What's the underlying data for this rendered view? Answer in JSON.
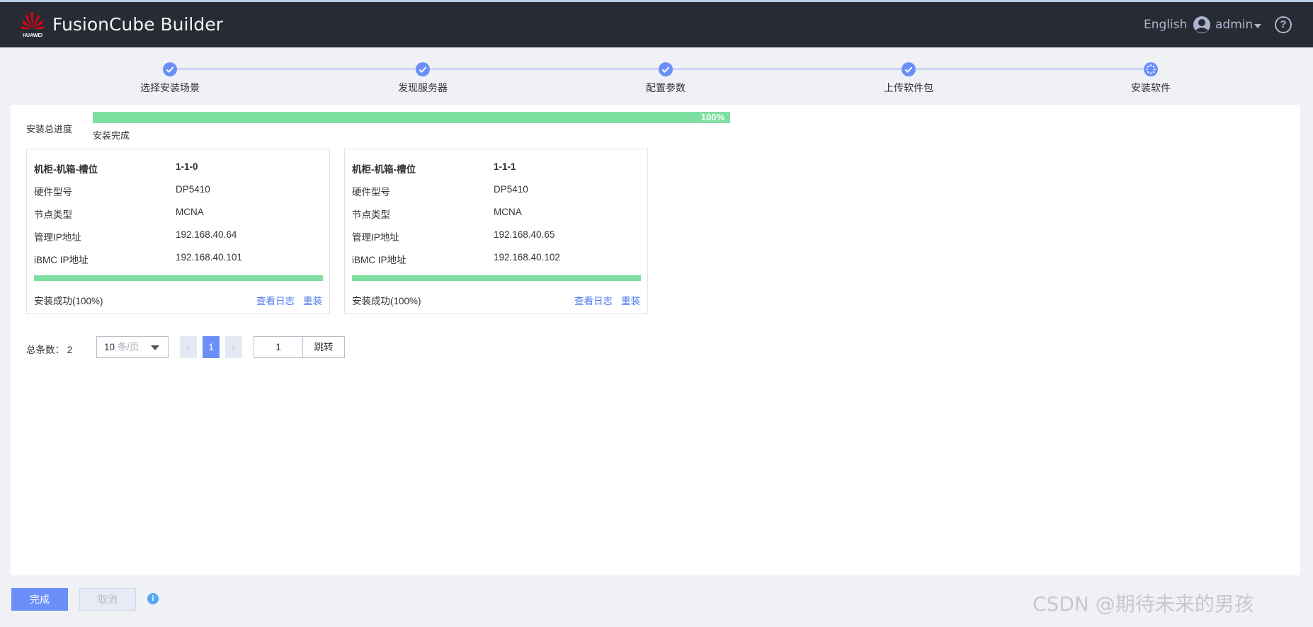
{
  "header": {
    "logo_text": "HUAWEI",
    "title": "FusionCube Builder",
    "language": "English",
    "user": "admin",
    "user_icon": "user-avatar-icon",
    "help_icon": "question-circle-icon",
    "help_glyph": "?"
  },
  "steps": [
    {
      "label": "选择安装场景",
      "status": "done"
    },
    {
      "label": "发现服务器",
      "status": "done"
    },
    {
      "label": "配置参数",
      "status": "done"
    },
    {
      "label": "上传软件包",
      "status": "done"
    },
    {
      "label": "安装软件",
      "status": "in-progress"
    }
  ],
  "overall": {
    "label": "安装总进度",
    "percent": 100,
    "percent_text": "100%",
    "status": "安装完成"
  },
  "cards": [
    {
      "rows": [
        {
          "k": "机柜-机箱-槽位",
          "v": "1-1-0"
        },
        {
          "k": "硬件型号",
          "v": "DP5410"
        },
        {
          "k": "节点类型",
          "v": "MCNA"
        },
        {
          "k": "管理IP地址",
          "v": "192.168.40.64"
        },
        {
          "k": "iBMC IP地址",
          "v": "192.168.40.101"
        }
      ],
      "percent": 100,
      "status": "安装成功(100%)",
      "view_log": "查看日志",
      "reinstall": "重装"
    },
    {
      "rows": [
        {
          "k": "机柜-机箱-槽位",
          "v": "1-1-1"
        },
        {
          "k": "硬件型号",
          "v": "DP5410"
        },
        {
          "k": "节点类型",
          "v": "MCNA"
        },
        {
          "k": "管理IP地址",
          "v": "192.168.40.65"
        },
        {
          "k": "iBMC IP地址",
          "v": "192.168.40.102"
        }
      ],
      "percent": 100,
      "status": "安装成功(100%)",
      "view_log": "查看日志",
      "reinstall": "重装"
    }
  ],
  "pagination": {
    "total_label": "总条数：",
    "total": "2",
    "page_size": "10",
    "page_size_unit": "条/页",
    "prev": "‹",
    "current": "1",
    "next": "›",
    "jump_value": "1",
    "jump_label": "跳转"
  },
  "footer": {
    "done": "完成",
    "cancel": "取消",
    "info_glyph": "i"
  },
  "watermark": "CSDN @期待未来的男孩",
  "colors": {
    "accent": "#6b8ff8",
    "success": "#7ddfa0",
    "header_bg": "#282b34",
    "link": "#4f7bf1"
  }
}
